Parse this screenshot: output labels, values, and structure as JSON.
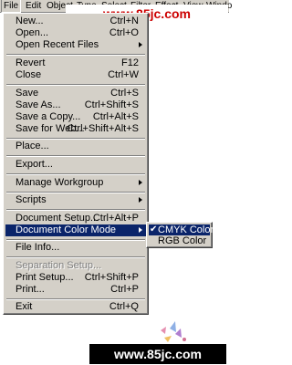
{
  "menubar": {
    "items": [
      {
        "label": "File"
      },
      {
        "label": "Edit"
      },
      {
        "label": "Object"
      },
      {
        "label": "Type"
      },
      {
        "label": "Select"
      },
      {
        "label": "Filter"
      },
      {
        "label": "Effect"
      },
      {
        "label": "View"
      },
      {
        "label": "Windo"
      }
    ]
  },
  "watermark_top": "www.85jc.com",
  "watermark_bottom": "www.85jc.com",
  "file_menu": {
    "items": [
      {
        "label": "New...",
        "shortcut": "Ctrl+N"
      },
      {
        "label": "Open...",
        "shortcut": "Ctrl+O"
      },
      {
        "label": "Open Recent Files"
      },
      {
        "label": "Revert",
        "shortcut": "F12"
      },
      {
        "label": "Close",
        "shortcut": "Ctrl+W"
      },
      {
        "label": "Save",
        "shortcut": "Ctrl+S"
      },
      {
        "label": "Save As...",
        "shortcut": "Ctrl+Shift+S"
      },
      {
        "label": "Save a Copy...",
        "shortcut": "Ctrl+Alt+S"
      },
      {
        "label": "Save for Web...",
        "shortcut": "Ctrl+Shift+Alt+S"
      },
      {
        "label": "Place..."
      },
      {
        "label": "Export..."
      },
      {
        "label": "Manage Workgroup"
      },
      {
        "label": "Scripts"
      },
      {
        "label": "Document Setup...",
        "shortcut": "Ctrl+Alt+P"
      },
      {
        "label": "Document Color Mode"
      },
      {
        "label": "File Info..."
      },
      {
        "label": "Separation Setup..."
      },
      {
        "label": "Print Setup...",
        "shortcut": "Ctrl+Shift+P"
      },
      {
        "label": "Print...",
        "shortcut": "Ctrl+P"
      },
      {
        "label": "Exit",
        "shortcut": "Ctrl+Q"
      }
    ]
  },
  "color_mode_submenu": {
    "items": [
      {
        "label": "CMYK Color",
        "check": "✔"
      },
      {
        "label": "RGB Color"
      }
    ]
  }
}
